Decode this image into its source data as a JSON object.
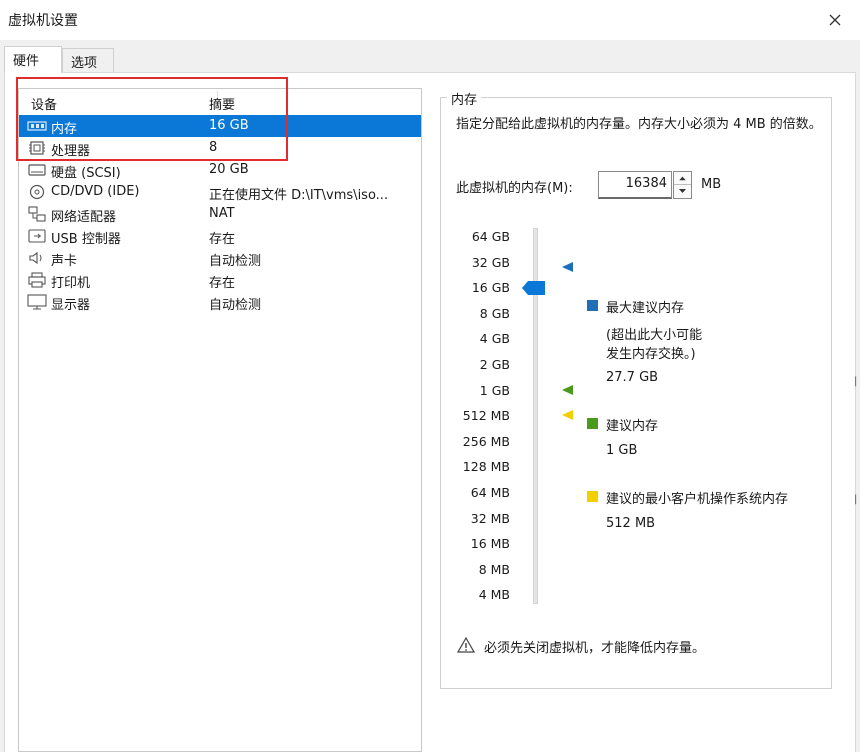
{
  "window": {
    "title": "虚拟机设置"
  },
  "tabs": [
    {
      "label": "硬件"
    },
    {
      "label": "选项"
    }
  ],
  "device_list": {
    "columns": {
      "device": "设备",
      "summary": "摘要"
    },
    "rows": [
      {
        "name": "内存",
        "summary": "16 GB",
        "icon": "memory-icon"
      },
      {
        "name": "处理器",
        "summary": "8",
        "icon": "processor-icon"
      },
      {
        "name": "硬盘 (SCSI)",
        "summary": "20 GB",
        "icon": "hard-disk-icon"
      },
      {
        "name": "CD/DVD (IDE)",
        "summary": "正在使用文件 D:\\IT\\vms\\iso...",
        "icon": "cd-dvd-icon"
      },
      {
        "name": "网络适配器",
        "summary": "NAT",
        "icon": "network-adapter-icon"
      },
      {
        "name": "USB 控制器",
        "summary": "存在",
        "icon": "usb-icon"
      },
      {
        "name": "声卡",
        "summary": "自动检测",
        "icon": "speaker-icon"
      },
      {
        "name": "打印机",
        "summary": "存在",
        "icon": "printer-icon"
      },
      {
        "name": "显示器",
        "summary": "自动检测",
        "icon": "monitor-icon"
      }
    ],
    "selected_index": 0
  },
  "memory": {
    "group_title": "内存",
    "description": "指定分配给此虚拟机的内存量。内存大小必须为 4 MB 的倍数。",
    "input_label": "此虚拟机的内存(M):",
    "input_value": "16384",
    "unit": "MB",
    "scale_ticks": [
      "64 GB",
      "32 GB",
      "16 GB",
      "8 GB",
      "4 GB",
      "2 GB",
      "1 GB",
      "512 MB",
      "256 MB",
      "128 MB",
      "64 MB",
      "32 MB",
      "16 MB",
      "8 MB",
      "4 MB"
    ],
    "current_tick": "16 GB",
    "max_recommended": {
      "label": "最大建议内存",
      "note_line1": "(超出此大小可能",
      "note_line2": "发生内存交换。)",
      "value": "27.7 GB",
      "color": "#1e6fb8"
    },
    "recommended": {
      "label": "建议内存",
      "value": "1 GB",
      "color": "#4a9a1c"
    },
    "min_guest": {
      "label": "建议的最小客户机操作系统内存",
      "value": "512 MB",
      "color": "#f2d000"
    },
    "warning": "必须先关闭虚拟机，才能降低内存量。"
  },
  "colors": {
    "selection": "#0b78d7",
    "highlight_box": "#e22b2b"
  }
}
